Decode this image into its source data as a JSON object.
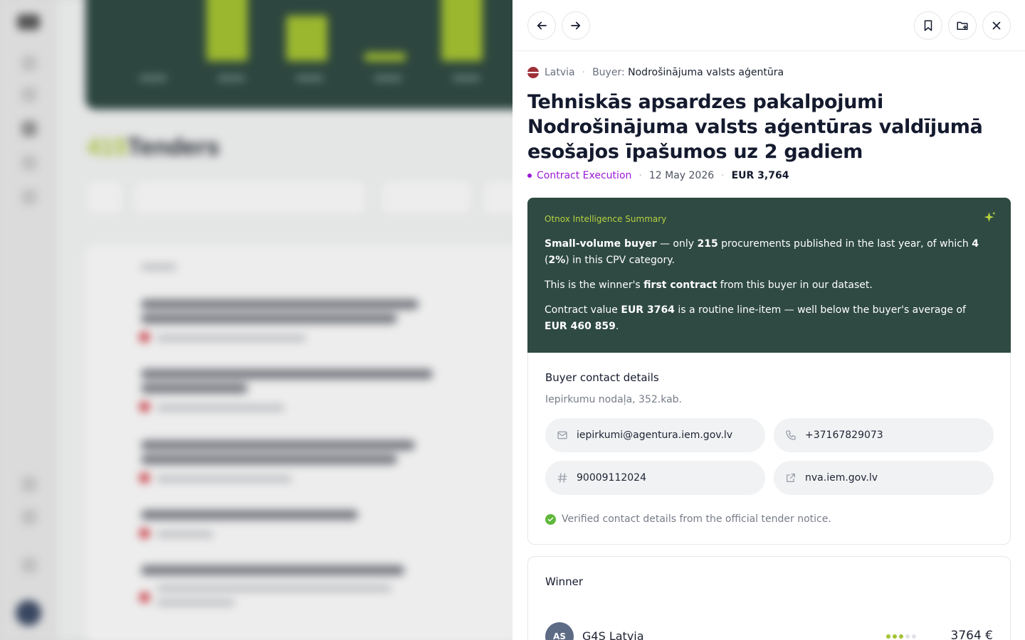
{
  "background": {
    "section_heading": "Tenders",
    "section_count": "415"
  },
  "topbar": {
    "prev_icon": "arrow-left-icon",
    "next_icon": "arrow-right-icon",
    "bookmark_icon": "bookmark-icon",
    "add_folder_icon": "folder-plus-icon",
    "close_icon": "close-icon"
  },
  "meta": {
    "country": "Latvia",
    "buyer_label": "Buyer:",
    "buyer_name": "Nodrošinājuma valsts aģentūra"
  },
  "tender": {
    "title": "Tehniskās apsardzes pakalpojumi Nodrošinājuma valsts aģentūras valdījumā esošajos īpašumos uz 2 gadiem",
    "stage": "Contract Execution",
    "date": "12 May 2026",
    "value": "EUR 3,764"
  },
  "ai_summary": {
    "label": "Otnox Intelligence Summary",
    "p1": {
      "b1": "Small-volume buyer",
      "t1": " — only ",
      "b2": "215",
      "t2": " procurements published in the last year, of which ",
      "b3": "4",
      "t3": " (",
      "b4": "2%",
      "t4": ") in this CPV category."
    },
    "p2": {
      "t1": "This is the winner's ",
      "b1": "first contract",
      "t2": " from this buyer in our dataset."
    },
    "p3": {
      "t1": "Contract value ",
      "b1": "EUR 3764",
      "t2": " is a routine line-item — well below the buyer's average of ",
      "b2": "EUR 460 859",
      "t3": "."
    }
  },
  "contact": {
    "title": "Buyer contact details",
    "department": "Iepirkumu nodaļa, 352.kab.",
    "email": "iepirkumi@agentura.iem.gov.lv",
    "phone": "+37167829073",
    "reg_number": "90009112024",
    "website": "nva.iem.gov.lv",
    "verified": "Verified contact details from the official tender notice."
  },
  "winner": {
    "title": "Winner",
    "initials": "AS",
    "name": "G4S Latvia",
    "score": 3,
    "score_max": 5,
    "amount": "3764 €"
  },
  "colors": {
    "ai_card_bg": "#2f4a43",
    "accent_lime": "#b6d13f",
    "stage_purple": "#9b19d6",
    "verified_green": "#5fb83a"
  }
}
